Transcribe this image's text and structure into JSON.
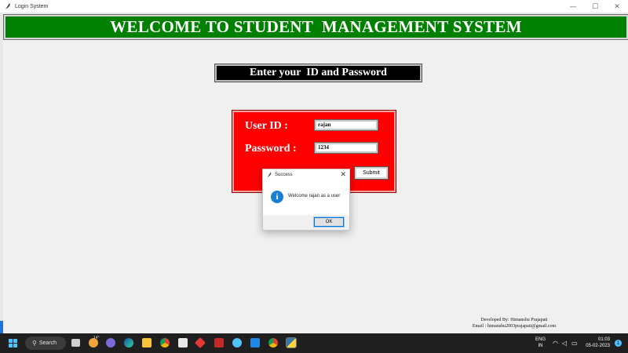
{
  "window": {
    "title": "Login System",
    "controls": {
      "minimize": "—",
      "maximize": "☐",
      "close": "✕"
    }
  },
  "app": {
    "banner": "WELCOME TO STUDENT  MANAGEMENT SYSTEM",
    "subtitle": "Enter your  ID and Password",
    "form": {
      "userid_label": "User ID :",
      "userid_value": "rajan",
      "password_label": "Password :",
      "password_value": "1234",
      "submit_label": "Submit"
    },
    "credits": {
      "line1": "Developed By: Himanshu Prajapati",
      "line2": "Email : himanshu2003prajapati@gmail.com"
    },
    "colors": {
      "banner_bg": "#008000",
      "subtitle_bg": "#000000",
      "panel_bg": "#ff0000"
    }
  },
  "dialog": {
    "title": "Success",
    "message": "Welcome rajan as a user",
    "ok_label": "OK",
    "icon": "info-icon"
  },
  "taskbar": {
    "search_label": "Search",
    "weather_temp": "14°",
    "language_line1": "ENG",
    "language_line2": "IN",
    "time": "01:03",
    "date": "05-02-2023",
    "notification_count": "1",
    "icons": [
      "windows-start-icon",
      "search-icon",
      "task-view-icon",
      "weather-icon",
      "teams-chat-icon",
      "edge-icon",
      "file-explorer-icon",
      "chrome-icon",
      "store-icon",
      "red-app-icon",
      "mcafee-icon",
      "chrome-2-icon",
      "vscode-icon",
      "chrome-3-icon",
      "python-icon"
    ]
  }
}
